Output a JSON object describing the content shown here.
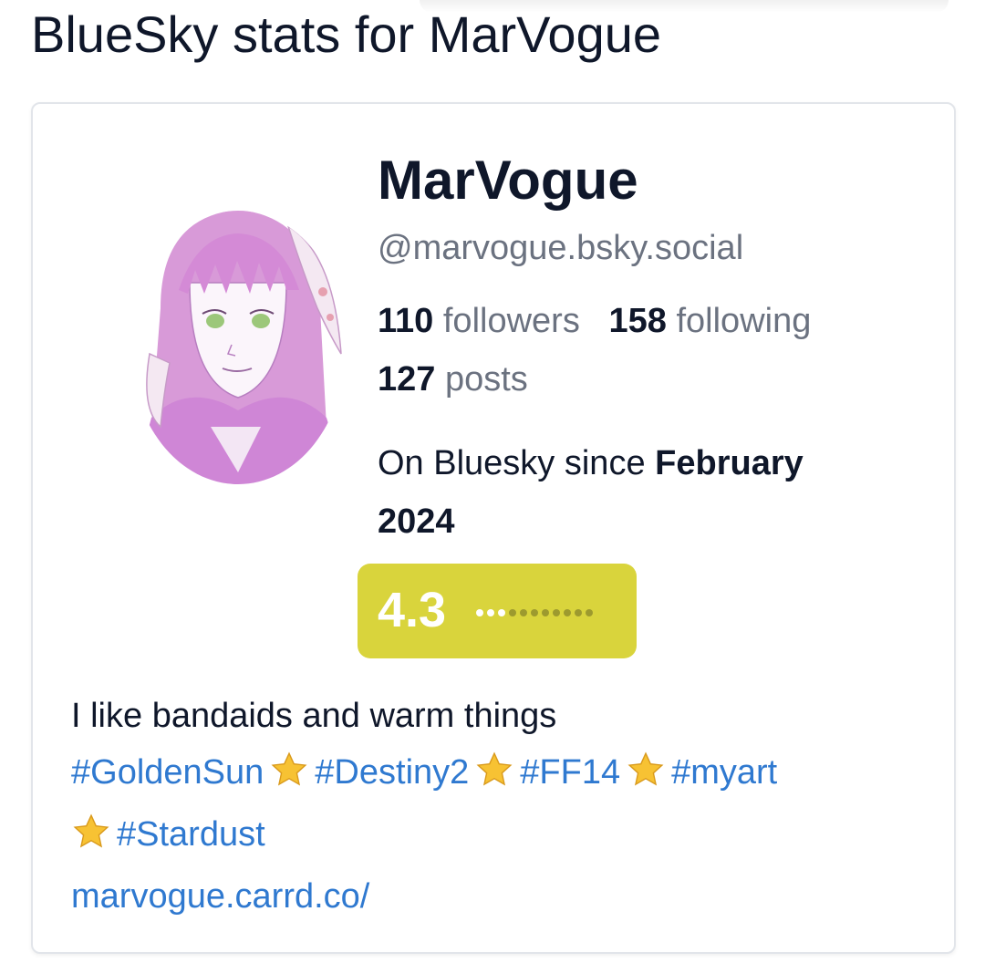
{
  "page": {
    "title": "BlueSky stats for MarVogue"
  },
  "profile": {
    "display_name": "MarVogue",
    "handle": "@marvogue.bsky.social",
    "followers_count": "110",
    "followers_label": "followers",
    "following_count": "158",
    "following_label": "following",
    "posts_count": "127",
    "posts_label": "posts",
    "since_prefix": "On Bluesky since",
    "since_date": "February 2024",
    "score": "4.3",
    "score_fraction": 0.3,
    "score_color": "#d9d43c",
    "bio_text": "I like bandaids and warm things",
    "tags": [
      "#GoldenSun",
      "#Destiny2",
      "#FF14",
      "#myart",
      "#Stardust"
    ],
    "separator_icon": "star-icon",
    "link": "marvogue.carrd.co/",
    "link_color": "#2f79d0"
  }
}
